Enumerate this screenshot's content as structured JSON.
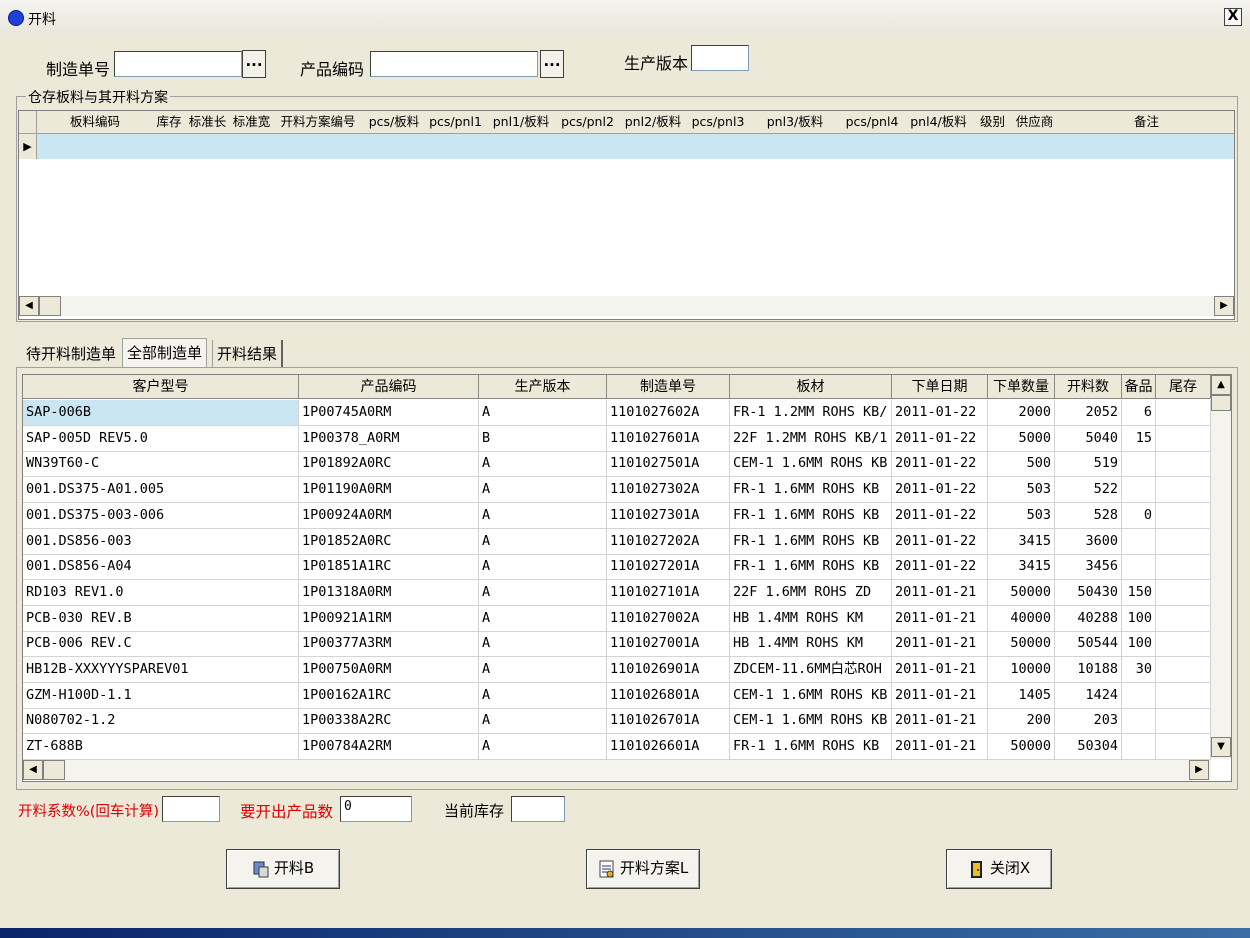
{
  "window": {
    "title": "开料",
    "close_label": "X"
  },
  "form": {
    "mo_label": "制造单号",
    "mo_value": "",
    "mo_browse": "...",
    "product_code_label": "产品编码",
    "product_code_value": "",
    "product_code_browse": "...",
    "version_label": "生产版本",
    "version_value": ""
  },
  "stock_group": {
    "legend": "仓存板料与其开料方案",
    "columns": [
      "板料编码",
      "库存",
      "标准长",
      "标准宽",
      "开料方案编号",
      "pcs/板料",
      "pcs/pnl1",
      "pnl1/板料",
      "pcs/pnl2",
      "pnl2/板料",
      "pcs/pnl3",
      "pnl3/板料",
      "pcs/pnl4",
      "pnl4/板料",
      "级别",
      "供应商",
      "备注"
    ],
    "row_indicator": "▶"
  },
  "tabs": [
    "待开料制造单",
    "全部制造单",
    "开料结果"
  ],
  "orders": {
    "columns": [
      "客户型号",
      "产品编码",
      "生产版本",
      "制造单号",
      "板材",
      "下单日期",
      "下单数量",
      "开料数",
      "备品",
      "尾存"
    ],
    "rows": [
      [
        "SAP-006B",
        "1P00745A0RM",
        "A",
        "1101027602A",
        "FR-1 1.2MM ROHS KB/",
        "2011-01-22",
        "2000",
        "2052",
        "6",
        ""
      ],
      [
        "SAP-005D REV5.0",
        "1P00378_A0RM",
        "B",
        "1101027601A",
        "22F 1.2MM ROHS KB/1",
        "2011-01-22",
        "5000",
        "5040",
        "15",
        ""
      ],
      [
        "WN39T60-C",
        "1P01892A0RC",
        "A",
        "1101027501A",
        "CEM-1 1.6MM ROHS KB",
        "2011-01-22",
        "500",
        "519",
        "",
        ""
      ],
      [
        "001.DS375-A01.005",
        "1P01190A0RM",
        "A",
        "1101027302A",
        "FR-1 1.6MM ROHS KB",
        "2011-01-22",
        "503",
        "522",
        "",
        ""
      ],
      [
        "001.DS375-003-006",
        "1P00924A0RM",
        "A",
        "1101027301A",
        "FR-1 1.6MM ROHS KB",
        "2011-01-22",
        "503",
        "528",
        "0",
        ""
      ],
      [
        "001.DS856-003",
        "1P01852A0RC",
        "A",
        "1101027202A",
        "FR-1 1.6MM ROHS KB",
        "2011-01-22",
        "3415",
        "3600",
        "",
        ""
      ],
      [
        "001.DS856-A04",
        "1P01851A1RC",
        "A",
        "1101027201A",
        "FR-1 1.6MM ROHS KB",
        "2011-01-22",
        "3415",
        "3456",
        "",
        ""
      ],
      [
        "RD103 REV1.0",
        "1P01318A0RM",
        "A",
        "1101027101A",
        "22F 1.6MM ROHS ZD",
        "2011-01-21",
        "50000",
        "50430",
        "150",
        ""
      ],
      [
        "PCB-030 REV.B",
        "1P00921A1RM",
        "A",
        "1101027002A",
        "HB 1.4MM ROHS KM",
        "2011-01-21",
        "40000",
        "40288",
        "100",
        ""
      ],
      [
        "PCB-006 REV.C",
        "1P00377A3RM",
        "A",
        "1101027001A",
        "HB 1.4MM ROHS KM",
        "2011-01-21",
        "50000",
        "50544",
        "100",
        ""
      ],
      [
        "HB12B-XXXYYYSPAREV01",
        "1P00750A0RM",
        "A",
        "1101026901A",
        "ZDCEM-11.6MM白芯ROH",
        "2011-01-21",
        "10000",
        "10188",
        "30",
        ""
      ],
      [
        "GZM-H100D-1.1",
        "1P00162A1RC",
        "A",
        "1101026801A",
        "CEM-1 1.6MM ROHS KB",
        "2011-01-21",
        "1405",
        "1424",
        "",
        ""
      ],
      [
        "N080702-1.2",
        "1P00338A2RC",
        "A",
        "1101026701A",
        "CEM-1 1.6MM ROHS KB",
        "2011-01-21",
        "200",
        "203",
        "",
        ""
      ],
      [
        "ZT-688B",
        "1P00784A2RM",
        "A",
        "1101026601A",
        "FR-1 1.6MM ROHS KB",
        "2011-01-21",
        "50000",
        "50304",
        "",
        ""
      ]
    ]
  },
  "bottom": {
    "coef_label": "开料系数%(回车计算)",
    "coef_value": "",
    "produce_label": "要开出产品数",
    "produce_value": "0",
    "stock_label": "当前库存",
    "stock_value": ""
  },
  "buttons": {
    "cut": "开料B",
    "plan": "开料方案L",
    "close": "关闭X"
  },
  "colors": {
    "selection": "#c9e6f2",
    "accent_red": "#e00000"
  }
}
